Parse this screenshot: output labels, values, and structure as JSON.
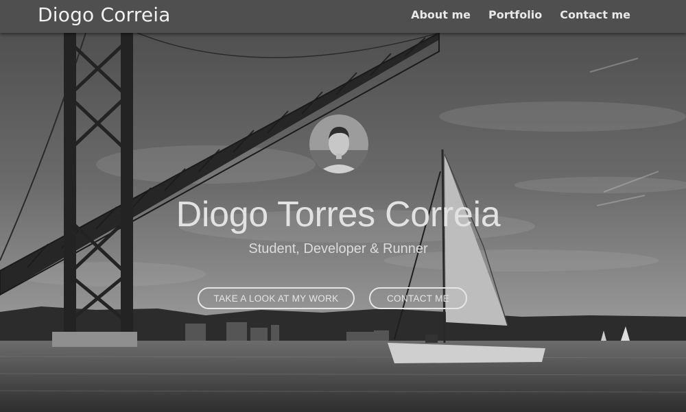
{
  "nav": {
    "brand": "Diogo Correia",
    "links": [
      "About me",
      "Portfolio",
      "Contact me"
    ]
  },
  "hero": {
    "name": "Diogo Torres Correia",
    "tagline": "Student, Developer & Runner",
    "primary_cta": "TAKE A LOOK AT MY WORK",
    "secondary_cta": "CONTACT ME"
  }
}
